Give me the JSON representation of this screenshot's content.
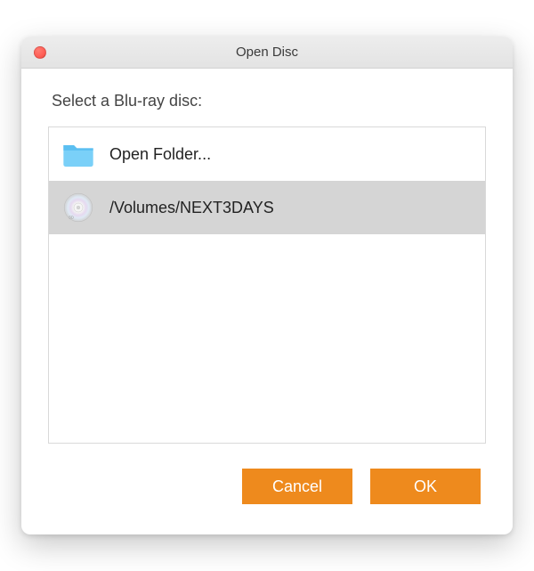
{
  "window": {
    "title": "Open Disc"
  },
  "content": {
    "prompt": "Select a Blu-ray disc:",
    "items": [
      {
        "label": "Open Folder...",
        "icon": "folder",
        "selected": false
      },
      {
        "label": "/Volumes/NEXT3DAYS",
        "icon": "disc",
        "selected": true
      }
    ]
  },
  "buttons": {
    "cancel": "Cancel",
    "ok": "OK"
  },
  "colors": {
    "accent": "#ee8a1d"
  }
}
